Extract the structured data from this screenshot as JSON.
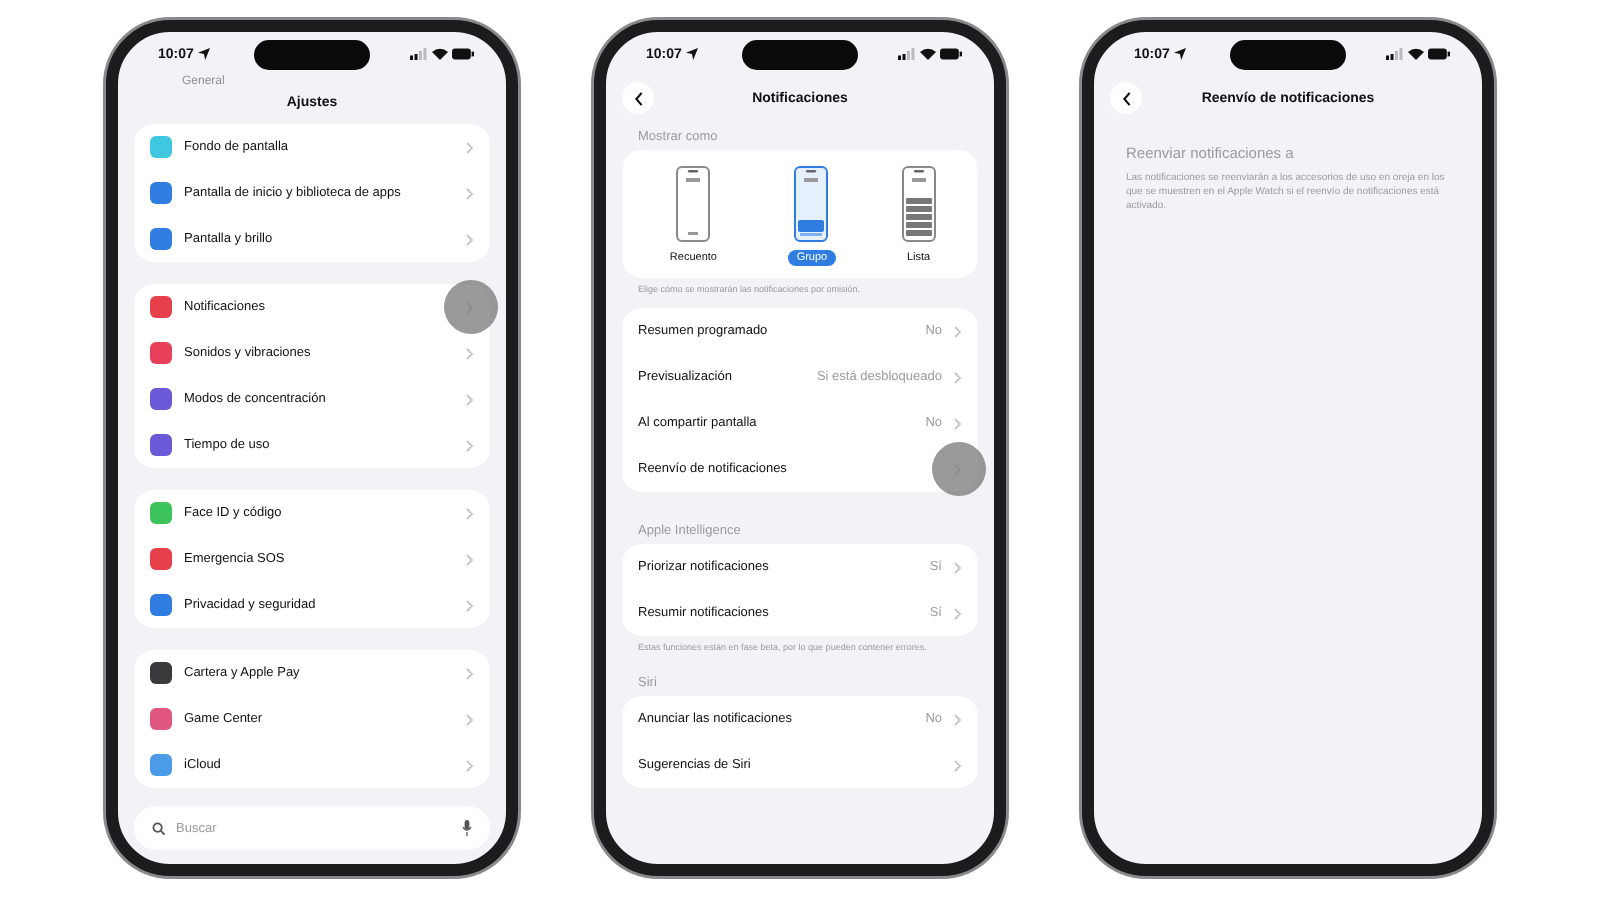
{
  "phones": [
    {
      "kind": "settings",
      "time": "10:07",
      "faded_item": "General",
      "title": "Ajustes",
      "groups": [
        [
          {
            "label": "Fondo de pantalla",
            "color": "#3fc6e0",
            "touched": false
          },
          {
            "label": "Pantalla de inicio y biblioteca de apps",
            "color": "#2f7de1",
            "touched": false
          },
          {
            "label": "Pantalla y brillo",
            "color": "#2f7de1",
            "touched": false
          }
        ],
        [
          {
            "label": "Notificaciones",
            "color": "#e8404a",
            "touched": true
          },
          {
            "label": "Sonidos y vibraciones",
            "color": "#e8405a",
            "touched": false
          },
          {
            "label": "Modos de concentración",
            "color": "#6a5ad8",
            "touched": false
          },
          {
            "label": "Tiempo de uso",
            "color": "#6a5ad8",
            "touched": false
          }
        ],
        [
          {
            "label": "Face ID y código",
            "color": "#3cc35a",
            "touched": false
          },
          {
            "label": "Emergencia SOS",
            "color": "#e8404a",
            "touched": false
          },
          {
            "label": "Privacidad y seguridad",
            "color": "#2f7de1",
            "touched": false
          }
        ],
        [
          {
            "label": "Cartera y Apple Pay",
            "color": "#3a3a3c",
            "touched": false
          },
          {
            "label": "Game Center",
            "color": "#e2577f",
            "touched": false
          },
          {
            "label": "iCloud",
            "color": "#4a9be8",
            "touched": false
          }
        ]
      ],
      "search": {
        "placeholder": "Buscar"
      }
    },
    {
      "kind": "notifications",
      "time": "10:07",
      "title": "Notificaciones",
      "display_header": "Mostrar como",
      "options": [
        {
          "label": "Recuento",
          "kind": "count",
          "selected": false
        },
        {
          "label": "Grupo",
          "kind": "stack",
          "selected": true
        },
        {
          "label": "Lista",
          "kind": "list",
          "selected": false
        }
      ],
      "display_footer": "Elige cómo se mostrarán las notificaciones por omisión.",
      "sections": [
        {
          "rows": [
            {
              "label": "Resumen programado",
              "value": "No",
              "touched": false
            },
            {
              "label": "Previsualización",
              "value": "Si está desbloqueado",
              "touched": false
            },
            {
              "label": "Al compartir pantalla",
              "value": "No",
              "touched": false
            },
            {
              "label": "Reenvío de notificaciones",
              "touched": true
            }
          ]
        },
        {
          "header": "Apple Intelligence",
          "rows": [
            {
              "label": "Priorizar notificaciones",
              "value": "Sí",
              "touched": false
            },
            {
              "label": "Resumir notificaciones",
              "value": "Sí",
              "touched": false
            }
          ],
          "footer": "Estas funciones están en fase beta, por lo que pueden contener errores."
        },
        {
          "header": "Siri",
          "rows": [
            {
              "label": "Anunciar las notificaciones",
              "value": "No",
              "touched": false
            },
            {
              "label": "Sugerencias de Siri",
              "touched": false
            }
          ]
        }
      ]
    },
    {
      "kind": "forwarding",
      "time": "10:07",
      "title": "Reenvío de notificaciones",
      "header": "Reenviar notificaciones a",
      "text": "Las notificaciones se reenviarán a los accesorios de uso en oreja en los que se muestren en el Apple Watch si el reenvío de notificaciones está activado."
    }
  ]
}
